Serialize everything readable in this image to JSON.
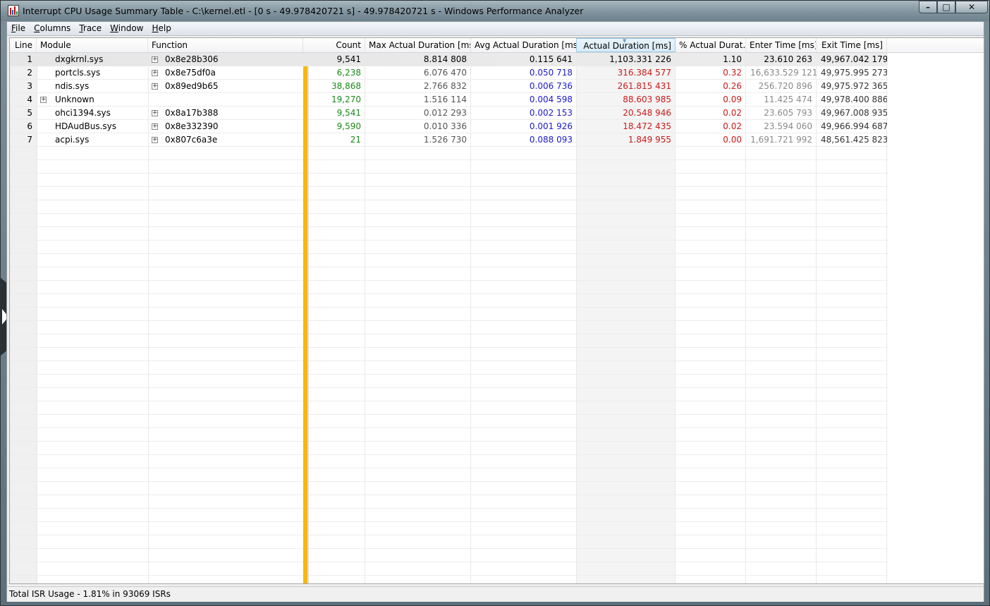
{
  "window": {
    "title": "Interrupt CPU Usage Summary Table - C:\\kernel.etl - [0 s - 49.978420721 s] - 49.978420721 s - Windows Performance Analyzer",
    "minimize_glyph": "–",
    "maximize_glyph": "□",
    "close_glyph": "✕"
  },
  "menu": [
    {
      "accel": "F",
      "rest": "ile"
    },
    {
      "accel": "C",
      "rest": "olumns"
    },
    {
      "accel": "T",
      "rest": "race"
    },
    {
      "accel": "W",
      "rest": "indow"
    },
    {
      "accel": "H",
      "rest": "elp"
    }
  ],
  "columns": {
    "line": "Line",
    "module": "Module",
    "function": "Function",
    "count": "Count",
    "max": "Max Actual Duration [ms]",
    "avg": "Avg Actual Duration [ms]",
    "actual": "Actual Duration [ms]",
    "pct": "% Actual Durat...",
    "enter": "Enter Time [ms]",
    "exit": "Exit Time [ms]",
    "sorted_column": "actual",
    "sort_direction": "descending"
  },
  "colors": {
    "count": "#1a8a1a",
    "max": "#555555",
    "avg": "#1a1acc",
    "actual": "#cc1a1a",
    "pct": "#cc1a1a",
    "enter": "#8a8a8a",
    "exit": "#333333",
    "accent_bar": "#f5b80e"
  },
  "rows": [
    {
      "line": "1",
      "module": "dxgkrnl.sys",
      "module_expand": false,
      "function": "0x8e28b306",
      "function_expand": true,
      "count": "9,541",
      "max": "8.814 808",
      "avg": "0.115 641",
      "actual": "1,103.331 226",
      "pct": "1.10",
      "enter": "23.610 263",
      "exit": "49,967.042 179",
      "selected": true
    },
    {
      "line": "2",
      "module": "portcls.sys",
      "module_expand": false,
      "function": "0x8e75df0a",
      "function_expand": true,
      "count": "6,238",
      "max": "6.076 470",
      "avg": "0.050 718",
      "actual": "316.384 577",
      "pct": "0.32",
      "enter": "16,633.529 121",
      "exit": "49,975.995 273",
      "selected": false
    },
    {
      "line": "3",
      "module": "ndis.sys",
      "module_expand": false,
      "function": "0x89ed9b65",
      "function_expand": true,
      "count": "38,868",
      "max": "2.766 832",
      "avg": "0.006 736",
      "actual": "261.815 431",
      "pct": "0.26",
      "enter": "256.720 896",
      "exit": "49,975.972 365",
      "selected": false
    },
    {
      "line": "4",
      "module": "Unknown",
      "module_expand": true,
      "function": "",
      "function_expand": false,
      "count": "19,270",
      "max": "1.516 114",
      "avg": "0.004 598",
      "actual": "88.603 985",
      "pct": "0.09",
      "enter": "11.425 474",
      "exit": "49,978.400 886",
      "selected": false
    },
    {
      "line": "5",
      "module": "ohci1394.sys",
      "module_expand": false,
      "function": "0x8a17b388",
      "function_expand": true,
      "count": "9,541",
      "max": "0.012 293",
      "avg": "0.002 153",
      "actual": "20.548 946",
      "pct": "0.02",
      "enter": "23.605 793",
      "exit": "49,967.008 935",
      "selected": false
    },
    {
      "line": "6",
      "module": "HDAudBus.sys",
      "module_expand": false,
      "function": "0x8e332390",
      "function_expand": true,
      "count": "9,590",
      "max": "0.010 336",
      "avg": "0.001 926",
      "actual": "18.472 435",
      "pct": "0.02",
      "enter": "23.594 060",
      "exit": "49,966.994 687",
      "selected": false
    },
    {
      "line": "7",
      "module": "acpi.sys",
      "module_expand": false,
      "function": "0x807c6a3e",
      "function_expand": true,
      "count": "21",
      "max": "1.526 730",
      "avg": "0.088 093",
      "actual": "1.849 955",
      "pct": "0.00",
      "enter": "1,691.721 992",
      "exit": "48,561.425 823",
      "selected": false
    }
  ],
  "status": {
    "text": "Total ISR Usage - 1.81% in 93069 ISRs"
  },
  "icons": {
    "app": "wpa-app-icon",
    "expand": "expand-plus-icon",
    "side_panel": "side-panel-toggle-icon"
  }
}
